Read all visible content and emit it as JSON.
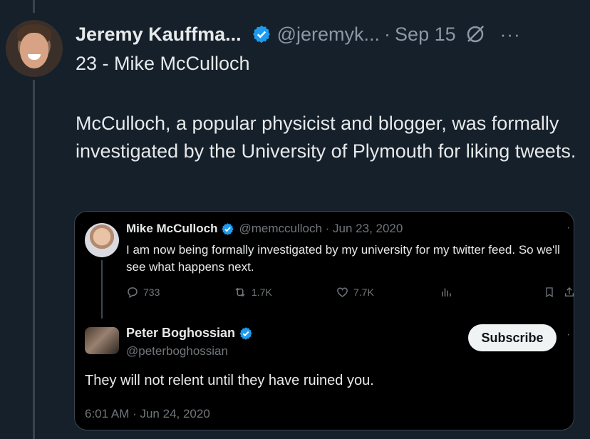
{
  "tweet": {
    "author_name": "Jeremy Kauffma...",
    "handle": "@jeremyk...",
    "separator": "·",
    "date": "Sep 15",
    "more": "···",
    "subtitle": "23 - Mike McCulloch",
    "text": "McCulloch, a popular physicist and blogger, was formally investigated by the University of Plymouth for liking tweets."
  },
  "quoted": {
    "author_name": "Mike McCulloch",
    "handle_date": "@memcculloch · Jun 23, 2020",
    "text": "I am now being formally investigated by my university for my twitter feed. So we'll see what happens next.",
    "replies": "733",
    "retweets": "1.7K",
    "likes": "7.7K"
  },
  "reply": {
    "author_name": "Peter Boghossian",
    "handle": "@peterboghossian",
    "subscribe_label": "Subscribe",
    "text": "They will not relent until they have ruined you.",
    "timestamp": "6:01 AM · Jun 24, 2020"
  },
  "colors": {
    "background": "#15202b",
    "verified": "#1d9bf0",
    "muted": "#8b98a5"
  }
}
